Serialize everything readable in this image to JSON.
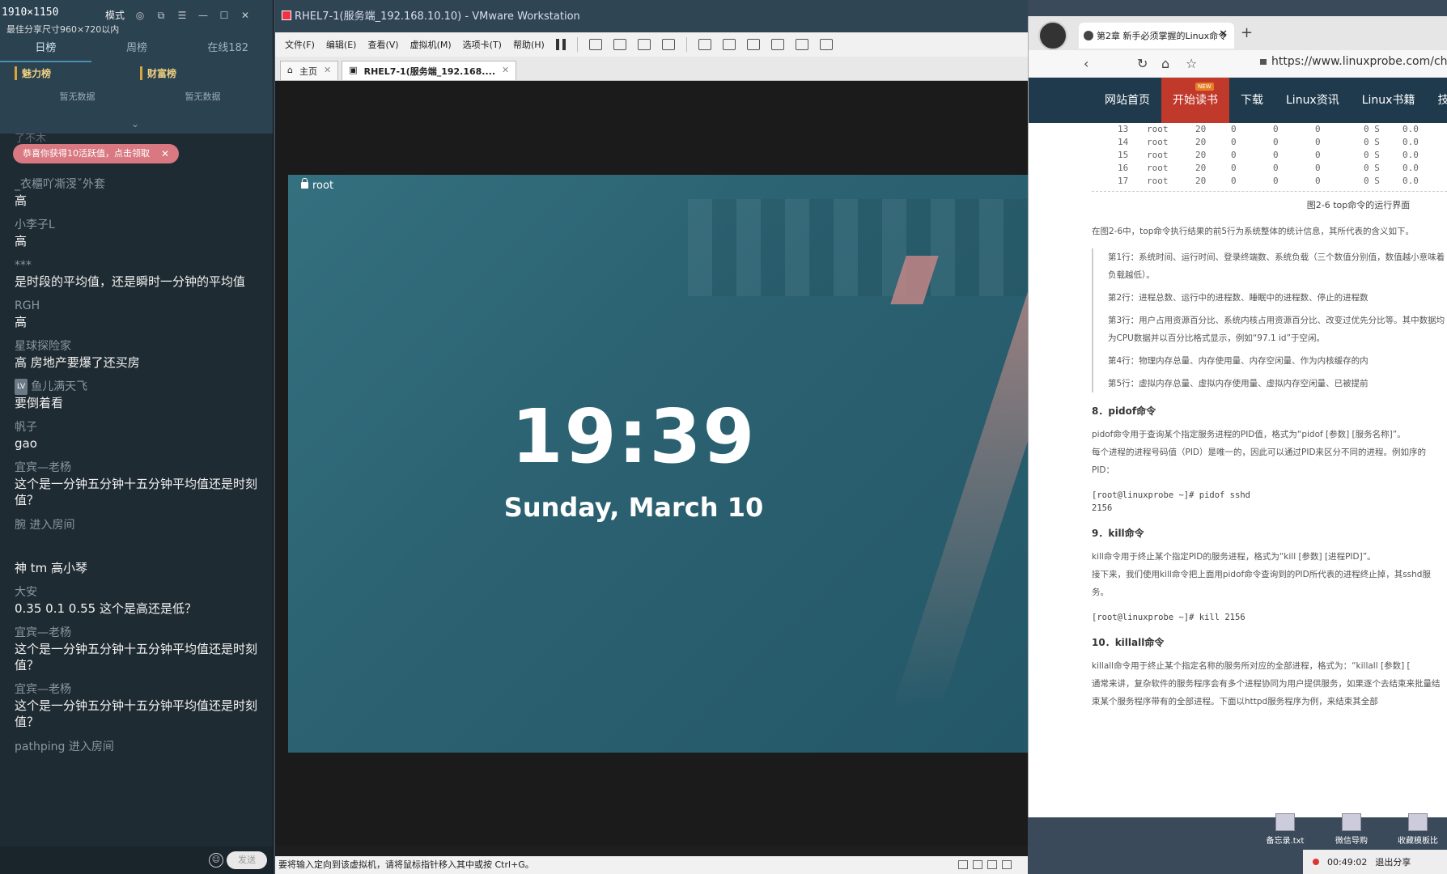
{
  "chat": {
    "dimensions": "1910×1150",
    "dim_sub": "最佳分享尺寸960×720以内",
    "mode_label": "模式",
    "tabs": [
      "日榜",
      "周榜",
      "在线182"
    ],
    "rank_cols": [
      {
        "title": "魅力榜",
        "empty": "暂无数据"
      },
      {
        "title": "财富榜",
        "empty": "暂无数据"
      }
    ],
    "ghost_name": "了不木",
    "toast": "恭喜你获得10活跃值，点击领取",
    "messages": [
      {
        "name": "_衣櫃吖凘渂ˇ外套",
        "text": "高"
      },
      {
        "name": "小李子L",
        "text": "高"
      },
      {
        "name": "***",
        "text": "是时段的平均值，还是瞬时一分钟的平均值"
      },
      {
        "name": "RGH",
        "text": "高"
      },
      {
        "name": "星球探险家",
        "text": "高 房地产要爆了还买房"
      },
      {
        "name": "鱼儿满天飞",
        "badge": "LV",
        "text": "要倒着看"
      },
      {
        "name": "帆子",
        "text": "gao"
      },
      {
        "name": "宜宾—老杨",
        "text": "这个是一分钟五分钟十五分钟平均值还是时刻值？"
      }
    ],
    "system1": "腕 进入房间",
    "messages2": [
      {
        "name": "",
        "text": "神 tm  高小琴"
      },
      {
        "name": "大安",
        "text": "0.35  0.1  0.55  这个是高还是低？"
      },
      {
        "name": "宜宾—老杨",
        "text": "这个是一分钟五分钟十五分钟平均值还是时刻值？"
      },
      {
        "name": "宜宾—老杨",
        "text": "这个是一分钟五分钟十五分钟平均值还是时刻值？"
      }
    ],
    "system2": "pathping 进入房间",
    "send_label": "发送"
  },
  "vmware": {
    "title": "RHEL7-1(服务端_192.168.10.10) - VMware Workstation",
    "menu": [
      "文件(F)",
      "编辑(E)",
      "查看(V)",
      "虚拟机(M)",
      "选项卡(T)",
      "帮助(H)"
    ],
    "tabs": [
      {
        "label": "主页"
      },
      {
        "label": "RHEL7-1(服务端_192.168...."
      }
    ],
    "guest_user": "root",
    "time": "19:39",
    "date": "Sunday, March 10",
    "status": "要将输入定向到该虚拟机，请将鼠标指针移入其中或按 Ctrl+G。"
  },
  "browser": {
    "tab_title": "第2章 新手必须掌握的Linux命令",
    "url": "https://www.linuxprobe.com/chap",
    "nav": [
      "网站首页",
      "开始读书",
      "下载",
      "Linux资讯",
      "Linux书籍",
      "技术干"
    ],
    "nav_new": "NEW",
    "procs": [
      [
        "13",
        "root",
        "20",
        "0",
        "0",
        "0",
        "0 S",
        "0.0"
      ],
      [
        "14",
        "root",
        "20",
        "0",
        "0",
        "0",
        "0 S",
        "0.0"
      ],
      [
        "15",
        "root",
        "20",
        "0",
        "0",
        "0",
        "0 S",
        "0.0"
      ],
      [
        "16",
        "root",
        "20",
        "0",
        "0",
        "0",
        "0 S",
        "0.0"
      ],
      [
        "17",
        "root",
        "20",
        "0",
        "0",
        "0",
        "0 S",
        "0.0"
      ]
    ],
    "caption": "图2-6  top命令的运行界面",
    "intro": "在图2-6中，top命令执行结果的前5行为系统整体的统计信息，其所代表的含义如下。",
    "lines": [
      "第1行：系统时间、运行时间、登录终端数、系统负载（三个数值分别值，数值越小意味着负载越低）。",
      "第2行：进程总数、运行中的进程数、睡眠中的进程数、停止的进程数",
      "第3行：用户占用资源百分比、系统内核占用资源百分比、改变过优先分比等。其中数据均为CPU数据并以百分比格式显示，例如“97.1 id”于空闲。",
      "第4行：物理内存总量、内存使用量、内存空闲量、作为内核缓存的内",
      "第5行：虚拟内存总量、虚拟内存使用量、虚拟内存空闲量、已被提前"
    ],
    "h8": "8．pidof命令",
    "p8a": "pidof命令用于查询某个指定服务进程的PID值，格式为“pidof [参数] [服务名称]”。",
    "p8b": "每个进程的进程号码值（PID）是唯一的，因此可以通过PID来区分不同的进程。例如序的PID：",
    "code8a": "[root@linuxprobe ~]# pidof sshd",
    "code8b": "2156",
    "h9": "9．kill命令",
    "p9a": "kill命令用于终止某个指定PID的服务进程，格式为“kill [参数] [进程PID]”。",
    "p9b": "接下来，我们使用kill命令把上面用pidof命令查询到的PID所代表的进程终止掉，其sshd服务。",
    "code9": "[root@linuxprobe ~]# kill 2156",
    "h10": "10．killall命令",
    "p10a": "killall命令用于终止某个指定名称的服务所对应的全部进程，格式为：“killall [参数] [",
    "p10b": "通常来讲，复杂软件的服务程序会有多个进程协同为用户提供服务，如果逐个去结束来批量结束某个服务程序带有的全部进程。下面以httpd服务程序为例，来结束其全部"
  },
  "desktop": {
    "icons": [
      "备忘录.txt",
      "微信导购",
      "收藏模板比"
    ],
    "rec_time": "00:49:02",
    "rec_exit": "退出分享"
  }
}
